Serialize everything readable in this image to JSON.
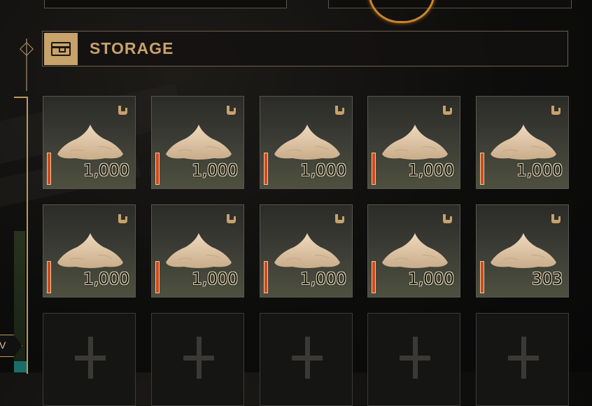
{
  "header": {
    "title": "STORAGE",
    "icon": "chest-icon"
  },
  "left_tab": {
    "label": "V"
  },
  "colors": {
    "accent": "#c7a26a",
    "durability": "#d04a1f",
    "ring": "#c9852e"
  },
  "slots": [
    {
      "item": "sand-pile",
      "quantity": "1,000"
    },
    {
      "item": "sand-pile",
      "quantity": "1,000"
    },
    {
      "item": "sand-pile",
      "quantity": "1,000"
    },
    {
      "item": "sand-pile",
      "quantity": "1,000"
    },
    {
      "item": "sand-pile",
      "quantity": "1,000"
    },
    {
      "item": "sand-pile",
      "quantity": "1,000"
    },
    {
      "item": "sand-pile",
      "quantity": "1,000"
    },
    {
      "item": "sand-pile",
      "quantity": "1,000"
    },
    {
      "item": "sand-pile",
      "quantity": "1,000"
    },
    {
      "item": "sand-pile",
      "quantity": "303"
    },
    {
      "item": null,
      "quantity": ""
    },
    {
      "item": null,
      "quantity": ""
    },
    {
      "item": null,
      "quantity": ""
    },
    {
      "item": null,
      "quantity": ""
    },
    {
      "item": null,
      "quantity": ""
    }
  ]
}
